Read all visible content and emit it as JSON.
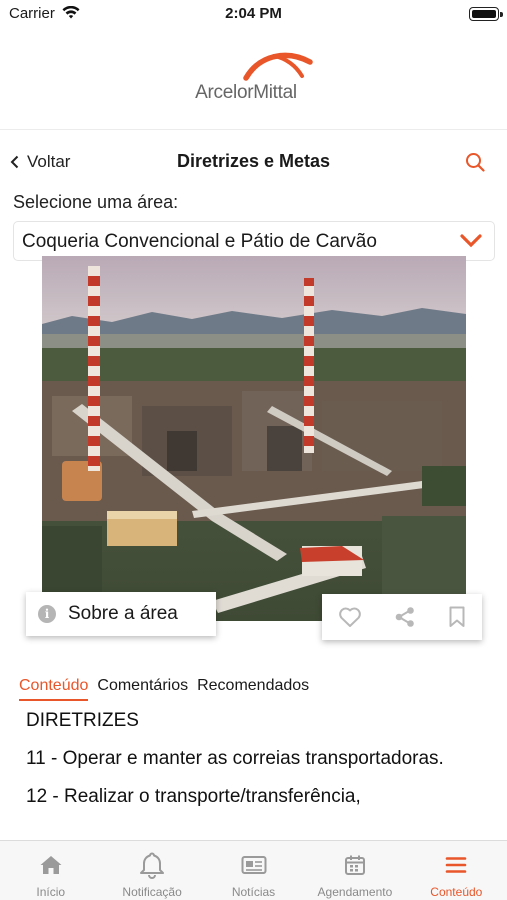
{
  "status_bar": {
    "carrier": "Carrier",
    "time": "2:04 PM"
  },
  "brand": {
    "name": "ArcelorMittal"
  },
  "nav": {
    "back_label": "Voltar",
    "title": "Diretrizes e Metas"
  },
  "area": {
    "prompt": "Selecione uma área:",
    "selected": "Coqueria Convencional e Pátio de Carvão"
  },
  "about_button": {
    "label": "Sobre a área"
  },
  "tabs": [
    {
      "label": "Conteúdo",
      "active": true
    },
    {
      "label": "Comentários",
      "active": false
    },
    {
      "label": "Recomendados",
      "active": false
    }
  ],
  "content": {
    "heading": "DIRETRIZES",
    "items": [
      "11 - Operar e manter as correias transportadoras.",
      "12 - Realizar o transporte/transferência,"
    ]
  },
  "tab_bar": {
    "items": [
      {
        "label": "Início",
        "icon": "home-icon"
      },
      {
        "label": "Notificação",
        "icon": "bell-icon"
      },
      {
        "label": "Notícias",
        "icon": "newspaper-icon"
      },
      {
        "label": "Agendamento",
        "icon": "calendar-icon"
      },
      {
        "label": "Conteúdo",
        "icon": "menu-icon",
        "active": true
      }
    ]
  },
  "colors": {
    "accent": "#e8562a",
    "inactive": "#8a8a8a"
  }
}
